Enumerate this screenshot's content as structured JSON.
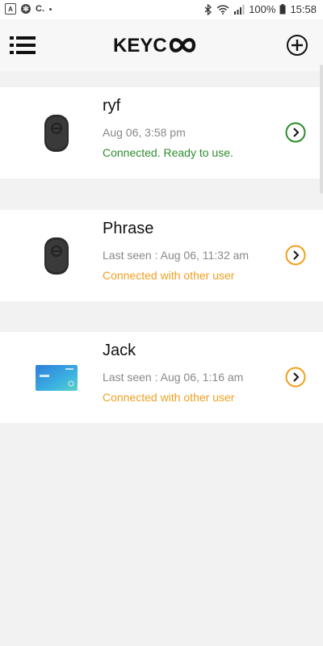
{
  "status_bar": {
    "left_icons": [
      "a-icon",
      "settings-circle-icon",
      "c-icon",
      "dot-icon"
    ],
    "left_text": "C.",
    "battery": "100%",
    "time": "15:58"
  },
  "header": {
    "logo_text": "KEYCO"
  },
  "devices": [
    {
      "name": "ryf",
      "meta": "Aug 06, 3:58 pm",
      "status": "Connected. Ready to use.",
      "status_color": "#2e8b2e",
      "chevron_color": "#2e8b2e",
      "thumb": "tag"
    },
    {
      "name": "Phrase",
      "meta": "Last seen : Aug 06, 11:32 am",
      "status": "Connected with other user",
      "status_color": "#f0a020",
      "chevron_color": "#f0a020",
      "thumb": "tag"
    },
    {
      "name": "Jack",
      "meta": "Last seen : Aug 06, 1:16 am",
      "status": "Connected with other user",
      "status_color": "#f0a020",
      "chevron_color": "#f0a020",
      "thumb": "card"
    }
  ],
  "colors": {
    "connected": "#2e8b2e",
    "other_user": "#f0a020",
    "background": "#f2f2f2"
  }
}
